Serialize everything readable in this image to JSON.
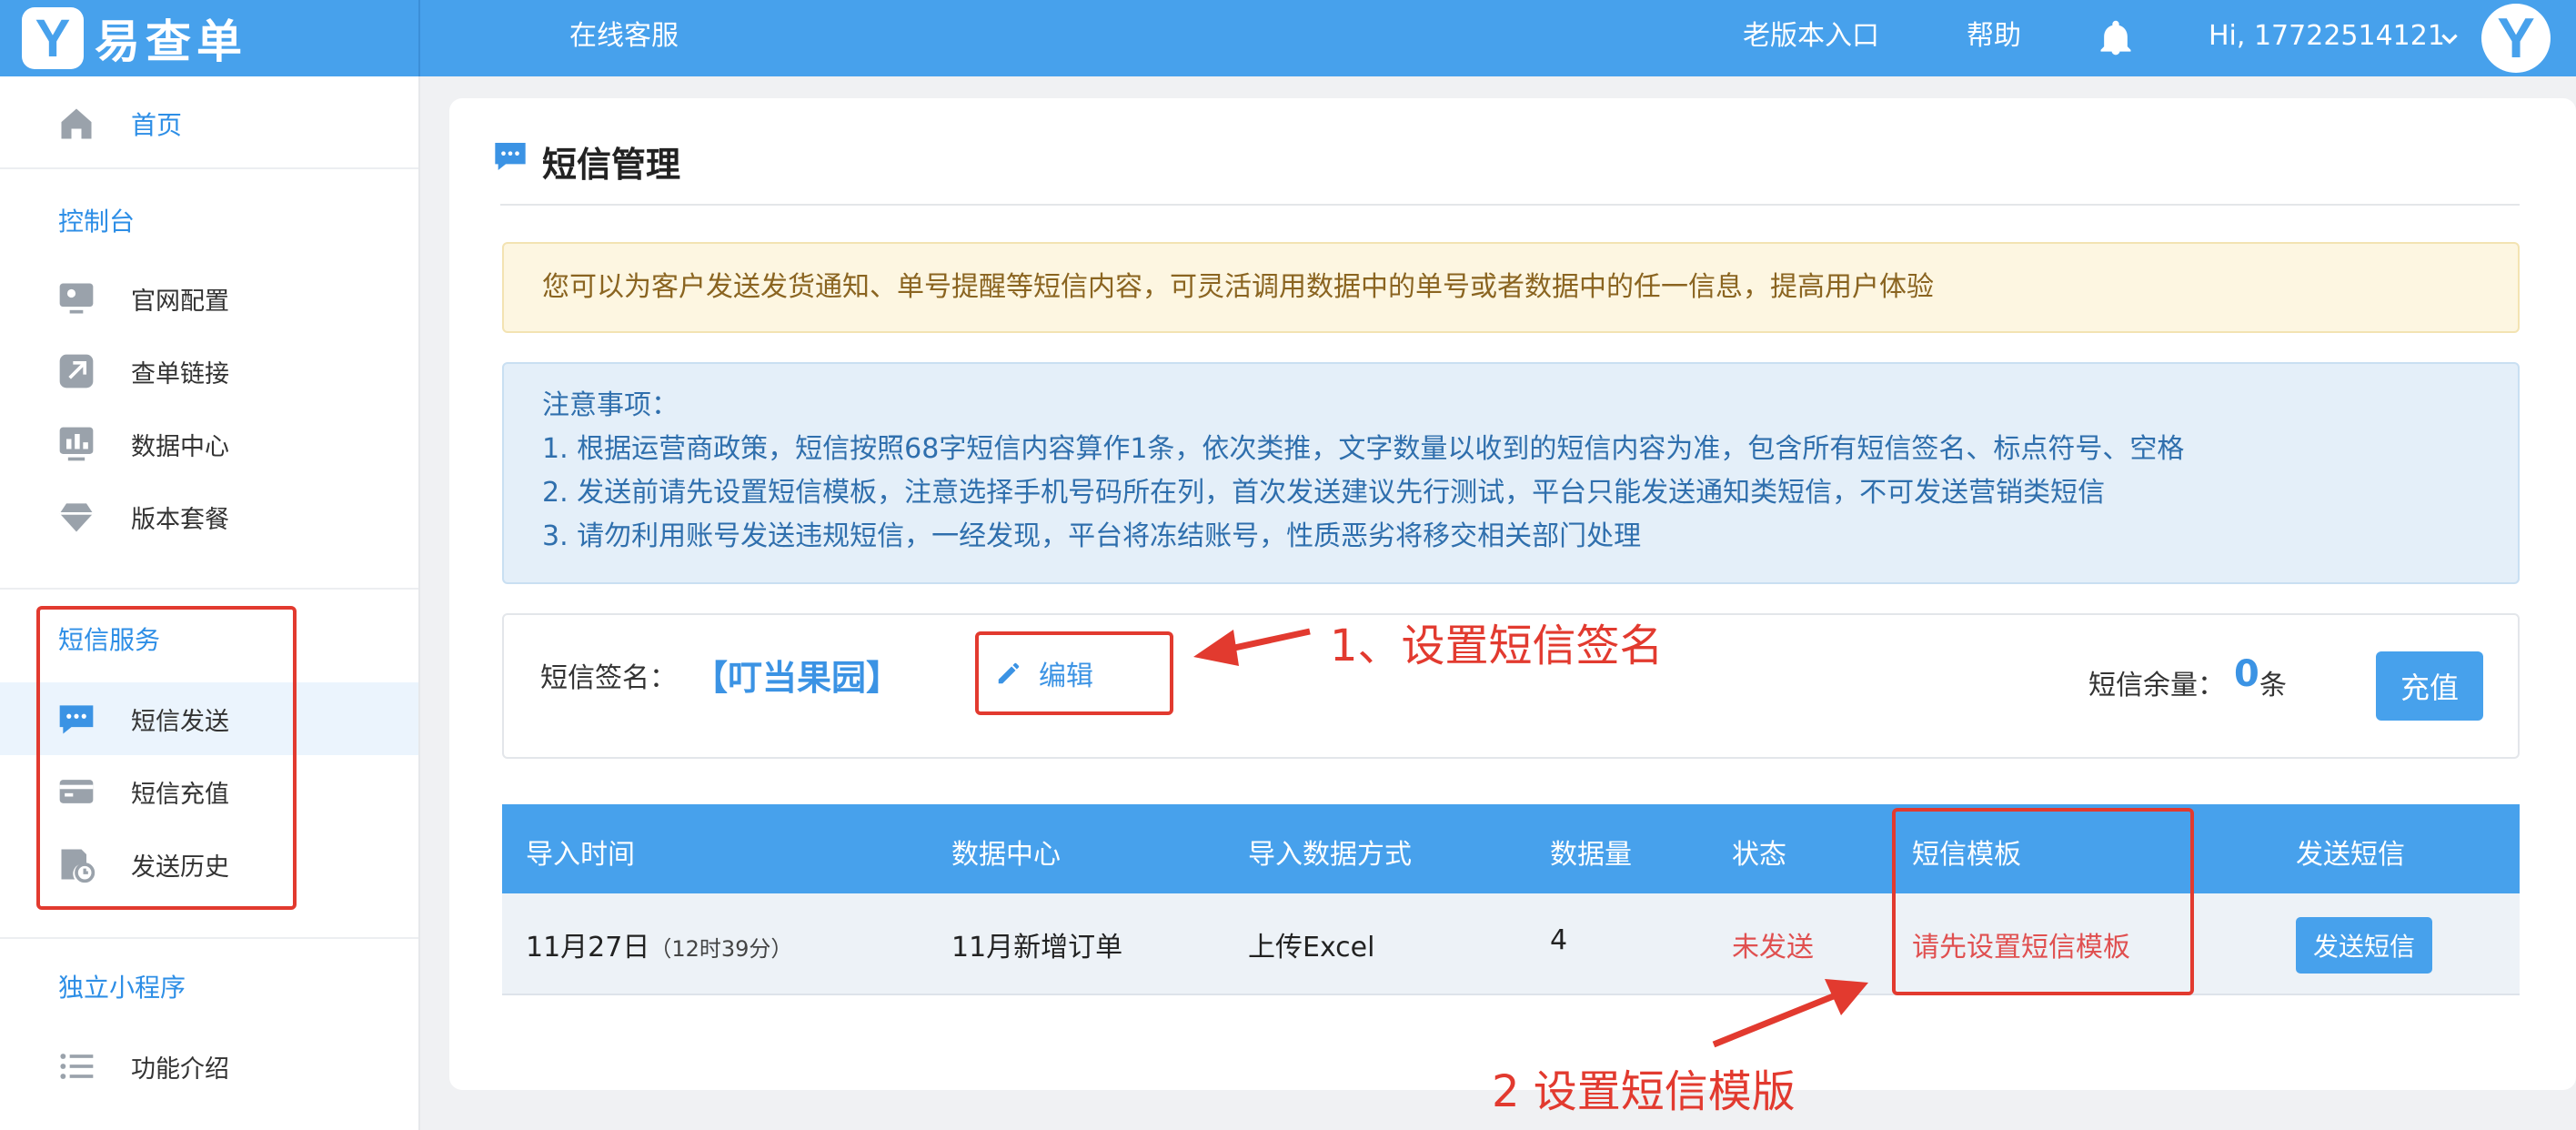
{
  "topbar": {
    "logo_mark": "Y",
    "logo_text": "易查单",
    "service": "在线客服",
    "old_version": "老版本入口",
    "help": "帮助",
    "user": "Hi, 17722514121",
    "avatar_mark": "Y"
  },
  "sidebar": {
    "home": "首页",
    "section_console": "控制台",
    "console_items": [
      "官网配置",
      "查单链接",
      "数据中心",
      "版本套餐"
    ],
    "section_sms": "短信服务",
    "sms_items": [
      "短信发送",
      "短信充值",
      "发送历史"
    ],
    "section_mini": "独立小程序",
    "mini_items": [
      "功能介绍"
    ]
  },
  "main": {
    "title": "短信管理",
    "notice_yellow": "您可以为客户发送发货通知、单号提醒等短信内容，可灵活调用数据中的单号或者数据中的任一信息，提高用户体验",
    "notice_title": "注意事项：",
    "notice_lines": [
      "1. 根据运营商政策，短信按照68字短信内容算作1条，依次类推，文字数量以收到的短信内容为准，包含所有短信签名、标点符号、空格",
      "2. 发送前请先设置短信模板，注意选择手机号码所在列，首次发送建议先行测试，平台只能发送通知类短信，不可发送营销类短信",
      "3. 请勿利用账号发送违规短信，一经发现，平台将冻结账号，性质恶劣将移交相关部门处理"
    ],
    "signature_label": "短信签名：",
    "signature_value": "【叮当果园】",
    "edit_label": "编辑",
    "balance_label": "短信余量：",
    "balance_value": "0",
    "balance_unit": "条",
    "recharge_label": "充值"
  },
  "table": {
    "headers": [
      "导入时间",
      "数据中心",
      "导入数据方式",
      "数据量",
      "状态",
      "短信模板",
      "发送短信"
    ],
    "row": {
      "date": "11月27日",
      "time": "（12时39分）",
      "data_center": "11月新增订单",
      "method": "上传Excel",
      "count": "4",
      "status": "未发送",
      "template": "请先设置短信模板",
      "send_label": "发送短信"
    }
  },
  "annotations": {
    "step1": "1、设置短信签名",
    "step2": "2 设置短信模版"
  },
  "colors": {
    "primary": "#47a1ec",
    "accent_text": "#2d8ee6",
    "annotation_red": "#e23a2f",
    "status_red": "#e05050"
  }
}
